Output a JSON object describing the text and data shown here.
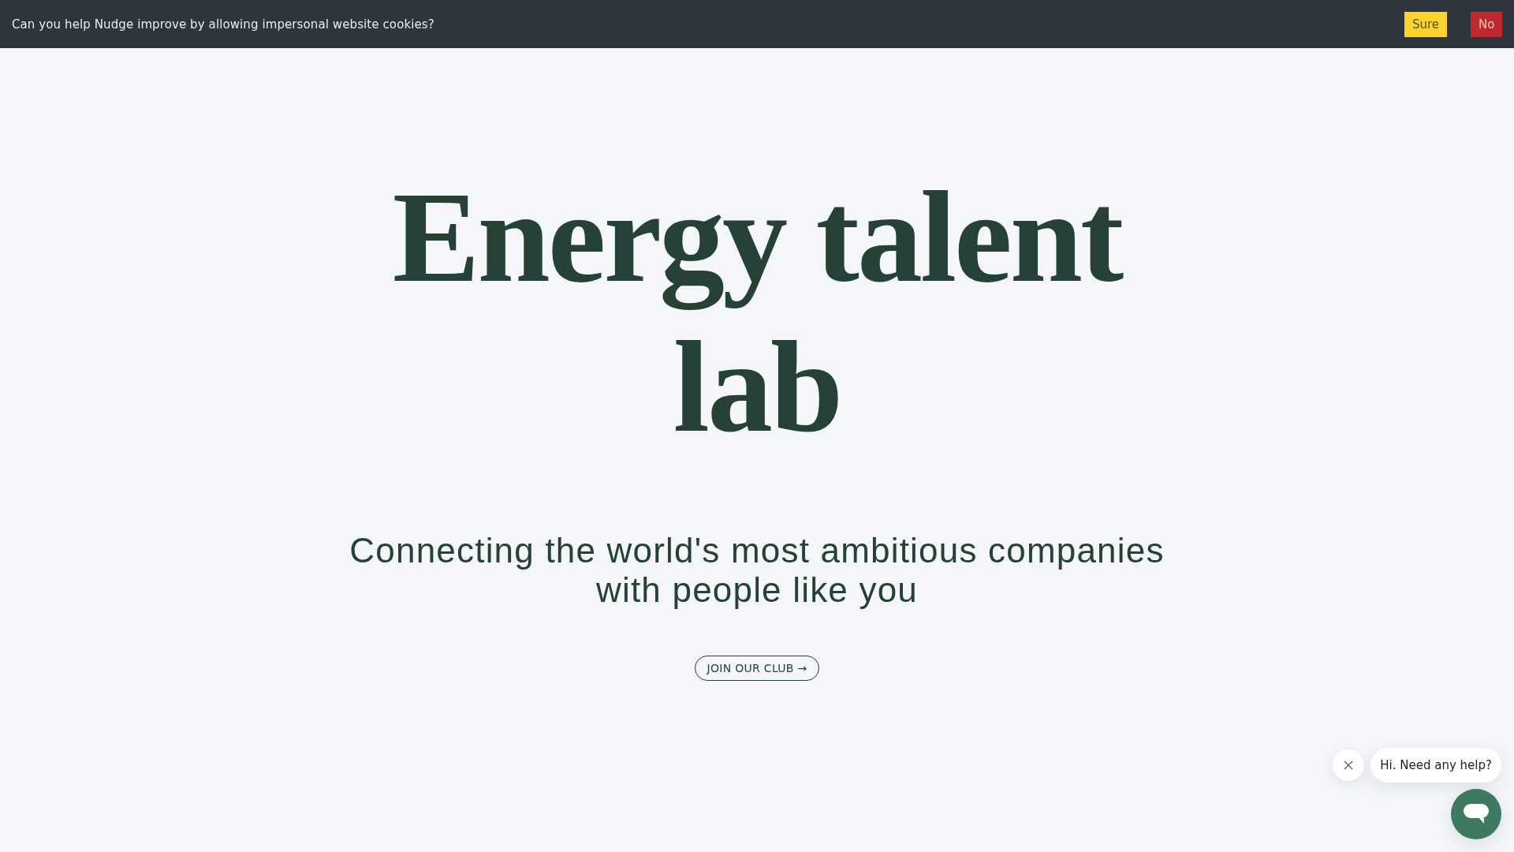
{
  "cookie_banner": {
    "message": "Can you help Nudge improve by allowing impersonal website cookies?",
    "buttons": [
      {
        "label": "Sure",
        "kind": "accept"
      },
      {
        "label": "No",
        "kind": "decline"
      }
    ]
  },
  "hero": {
    "title": "Energy talent lab",
    "subtitle": "Connecting the world's most ambitious companies with people like you",
    "cta": "JOIN OUR CLUB →"
  },
  "chat_widget": {
    "greeting": "Hi. Need any help?"
  }
}
